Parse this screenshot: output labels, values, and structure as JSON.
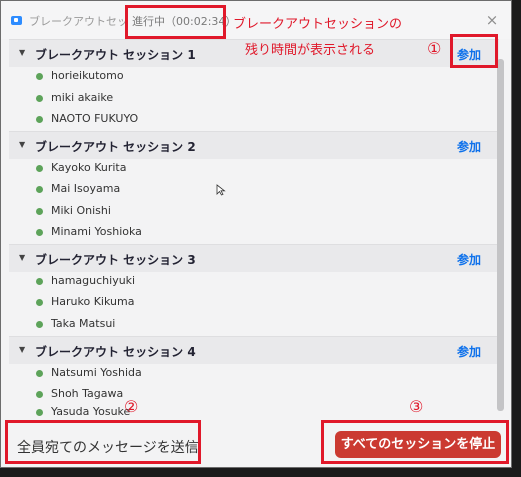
{
  "window": {
    "title": "ブレークアウトセッション",
    "status": "進行中（00:02:34）",
    "close_glyph": "×"
  },
  "annotations": {
    "note_line1": "ブレークアウトセッションの",
    "note_line2": "残り時間が表示される",
    "num1": "①",
    "num2": "②",
    "num3": "③",
    "color": "#e0182a"
  },
  "join_label": "参加",
  "groups": [
    {
      "name": "ブレークアウト セッション 1",
      "members": [
        "horieikutomo",
        "miki akaike",
        "NAOTO FUKUYO"
      ]
    },
    {
      "name": "ブレークアウト セッション 2",
      "members": [
        "Kayoko Kurita",
        "Mai Isoyama",
        "Miki Onishi",
        "Minami Yoshioka"
      ]
    },
    {
      "name": "ブレークアウト セッション 3",
      "members": [
        "hamaguchiyuki",
        "Haruko Kikuma",
        "Taka Matsui"
      ]
    },
    {
      "name": "ブレークアウト セッション 4",
      "members": [
        "Natsumi Yoshida",
        "Shoh Tagawa",
        "Yasuda Yosuke"
      ]
    }
  ],
  "footer": {
    "broadcast_label": "全員宛てのメッセージを送信",
    "broadcast_chevron": "⌄",
    "stop_label": "すべてのセッションを停止"
  },
  "icons": {
    "app": "zoom-app-icon",
    "caret": "caret-down-icon",
    "member": "online-status-icon",
    "cursor": "mouse-pointer-icon"
  },
  "colors": {
    "accent_link": "#0e71eb",
    "stop_button": "#cb3a31",
    "online_dot": "#5da35a"
  }
}
